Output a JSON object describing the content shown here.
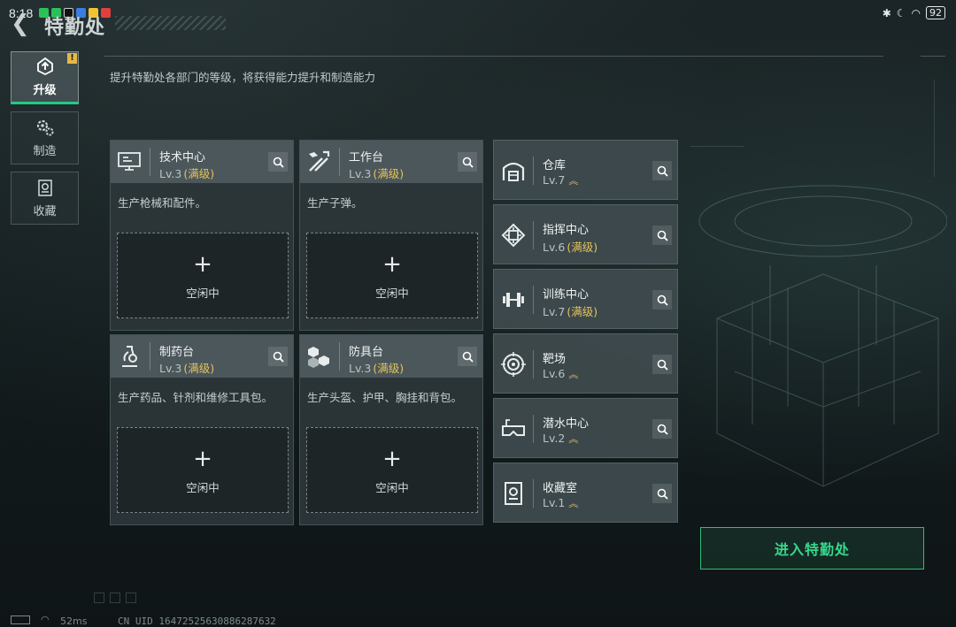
{
  "status_bar": {
    "time": "8:18",
    "battery": "92",
    "app_icons": [
      "#2bc15a",
      "#2bc15a",
      "#111111",
      "#3b7de0",
      "#f2c230",
      "#e04040"
    ]
  },
  "header": {
    "back_icon": "back-arrow-icon",
    "title": "特勤处",
    "subtitle": "提升特勤处各部门的等级，将获得能力提升和制造能力"
  },
  "sidebar": {
    "items": [
      {
        "label": "升级",
        "icon": "upgrade-icon",
        "active": true,
        "badge": "!"
      },
      {
        "label": "制造",
        "icon": "gear-icon",
        "active": false
      },
      {
        "label": "收藏",
        "icon": "collection-icon",
        "active": false
      }
    ]
  },
  "departments": [
    {
      "name": "技术中心",
      "level": "Lv.3",
      "status": "(满级)",
      "desc": "生产枪械和配件。",
      "slot_label": "空闲中",
      "icon": "computer-icon"
    },
    {
      "name": "工作台",
      "level": "Lv.3",
      "status": "(满级)",
      "desc": "生产子弹。",
      "slot_label": "空闲中",
      "icon": "tools-icon"
    },
    {
      "name": "制药台",
      "level": "Lv.3",
      "status": "(满级)",
      "desc": "生产药品、针剂和维修工具包。",
      "slot_label": "空闲中",
      "icon": "microscope-icon"
    },
    {
      "name": "防具台",
      "level": "Lv.3",
      "status": "(满级)",
      "desc": "生产头盔、护甲、胸挂和背包。",
      "slot_label": "空闲中",
      "icon": "armor-icon"
    }
  ],
  "facilities": [
    {
      "name": "仓库",
      "level": "Lv.7",
      "status": "",
      "upgradable": true,
      "icon": "warehouse-icon"
    },
    {
      "name": "指挥中心",
      "level": "Lv.6",
      "status": "(满级)",
      "upgradable": false,
      "icon": "chip-icon"
    },
    {
      "name": "训练中心",
      "level": "Lv.7",
      "status": "(满级)",
      "upgradable": false,
      "icon": "dumbbell-icon"
    },
    {
      "name": "靶场",
      "level": "Lv.6",
      "status": "",
      "upgradable": true,
      "icon": "target-icon"
    },
    {
      "name": "潜水中心",
      "level": "Lv.2",
      "status": "",
      "upgradable": true,
      "icon": "diving-mask-icon"
    },
    {
      "name": "收藏室",
      "level": "Lv.1",
      "status": "",
      "upgradable": true,
      "icon": "vault-icon"
    }
  ],
  "upgrade_chevron": "︽",
  "enter_button": {
    "label": "进入特勤处"
  },
  "footer": {
    "ping": "52ms",
    "uid": "CN UID 16472525630886287632"
  },
  "colors": {
    "accent_green": "#22c985",
    "max_gold": "#e6c35c"
  }
}
